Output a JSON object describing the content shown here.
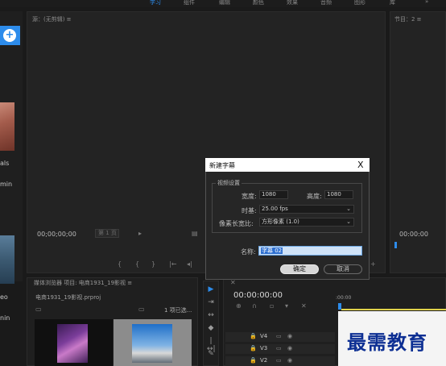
{
  "workspace_tabs": [
    "学习",
    "组件",
    "编辑",
    "颜色",
    "效果",
    "音频",
    "图形",
    "库"
  ],
  "workspace_more": "»",
  "left_panel": {
    "add_icon": "plus-circle-icon",
    "text_1": "als",
    "text_2": "min",
    "text_3": "eo",
    "text_4": "nin"
  },
  "source_monitor": {
    "title": "源：(无剪辑) ≡",
    "timecode": "00;00;00;00",
    "page_selector": "第 1 页"
  },
  "program_monitor": {
    "title": "节目：2 ≡",
    "timecode": "00:00:00"
  },
  "project_panel": {
    "tabs": "媒体浏览器    项目: 电商1931_19影视 ≡",
    "file_name": "电商1931_19影视.prproj",
    "selection_count": "1 项已选..."
  },
  "timeline": {
    "timecode": "00:00:00:00",
    "ruler_label": ":00:00",
    "tracks": [
      "V4",
      "V3",
      "V2"
    ]
  },
  "watermark": "最需教育",
  "dialog": {
    "title": "新建字幕",
    "close_label": "X",
    "section_label": "视频设置",
    "width_label": "宽度:",
    "width_value": "1080",
    "height_label": "高度:",
    "height_value": "1080",
    "timebase_label": "时基:",
    "timebase_value": "25.00 fps",
    "pixel_aspect_label": "像素长宽比:",
    "pixel_aspect_value": "方形像素 (1.0)",
    "name_label": "名称:",
    "name_value": "字幕 02",
    "ok_label": "确定",
    "cancel_label": "取消"
  }
}
